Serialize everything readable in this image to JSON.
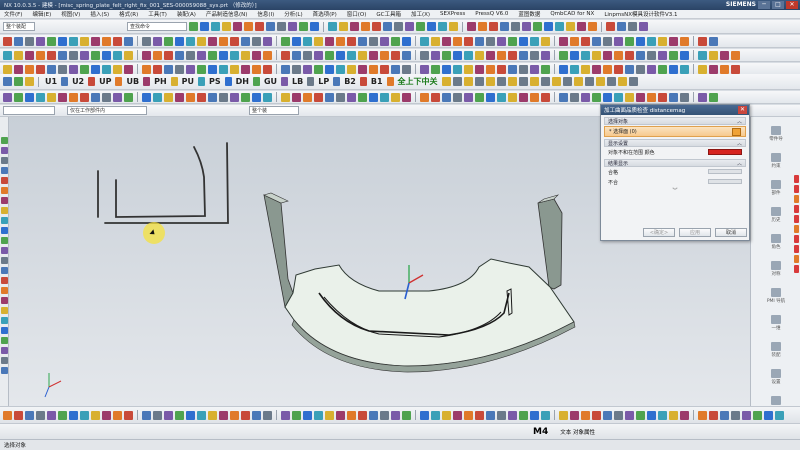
{
  "window": {
    "title": "NX 10.0.3.5 - 建模 - [misc_spring_plate_felt_right_fix_001_SES-000059088_sys.prt （修改的）]",
    "brand": "SIEMENS",
    "minimize": "─",
    "maximize": "□",
    "close": "✕"
  },
  "menubar": {
    "items": [
      "文件(F)",
      "编辑(E)",
      "视图(V)",
      "插入(S)",
      "格式(R)",
      "工具(T)",
      "装配(A)",
      "产品制造信息(N)",
      "信息(I)",
      "分析(L)",
      "首选项(P)",
      "窗口(O)",
      "GC工具箱",
      "加工(X)",
      "SEXPress",
      "PressQ V6.0",
      "蓝图数据",
      "QmbCAD for NX",
      "LinpmsNX模具设计软件V3.1"
    ]
  },
  "toolbar": {
    "text_buttons": [
      "U1",
      "U2",
      "UP",
      "UB",
      "PH",
      "PU",
      "PS",
      "DH",
      "GU",
      "LB",
      "LP",
      "B2",
      "B1"
    ],
    "filter_combo": "整个装配",
    "select_combo": "仅在工作部件内",
    "layer_combo": "整个装",
    "search_placeholder": "查找命令",
    "m4_label": "M4",
    "chinese_cmd": "全上下中关"
  },
  "dialog": {
    "title": "加工曲面品质检查 distancemag",
    "section_select": "选择对象",
    "select_row": "* 选择面 (0)",
    "section_display": "显示设置",
    "display_row": "对象不和在范围 颜色",
    "section_info": "结果显示",
    "row_pass": "合格",
    "row_fail": "不合",
    "ok": "<确定>",
    "apply": "应用",
    "cancel": "取消"
  },
  "right_panel": {
    "items": [
      "零件导",
      "约束",
      "部件",
      "历史",
      "角色",
      "对称",
      "PMI 导航",
      "一维",
      "装配",
      "设置",
      "部件导"
    ]
  },
  "statusbar": {
    "text": "选择对象",
    "bottom_chinese": "文本 对象属性"
  },
  "colors": {
    "title_bg": "#345275",
    "accent_red": "#d6231f",
    "select_orange": "#f7c98d",
    "viewport_top": "#c8cfd7",
    "viewport_bottom": "#e6e9ed",
    "part_face": "#eaf1ea"
  }
}
